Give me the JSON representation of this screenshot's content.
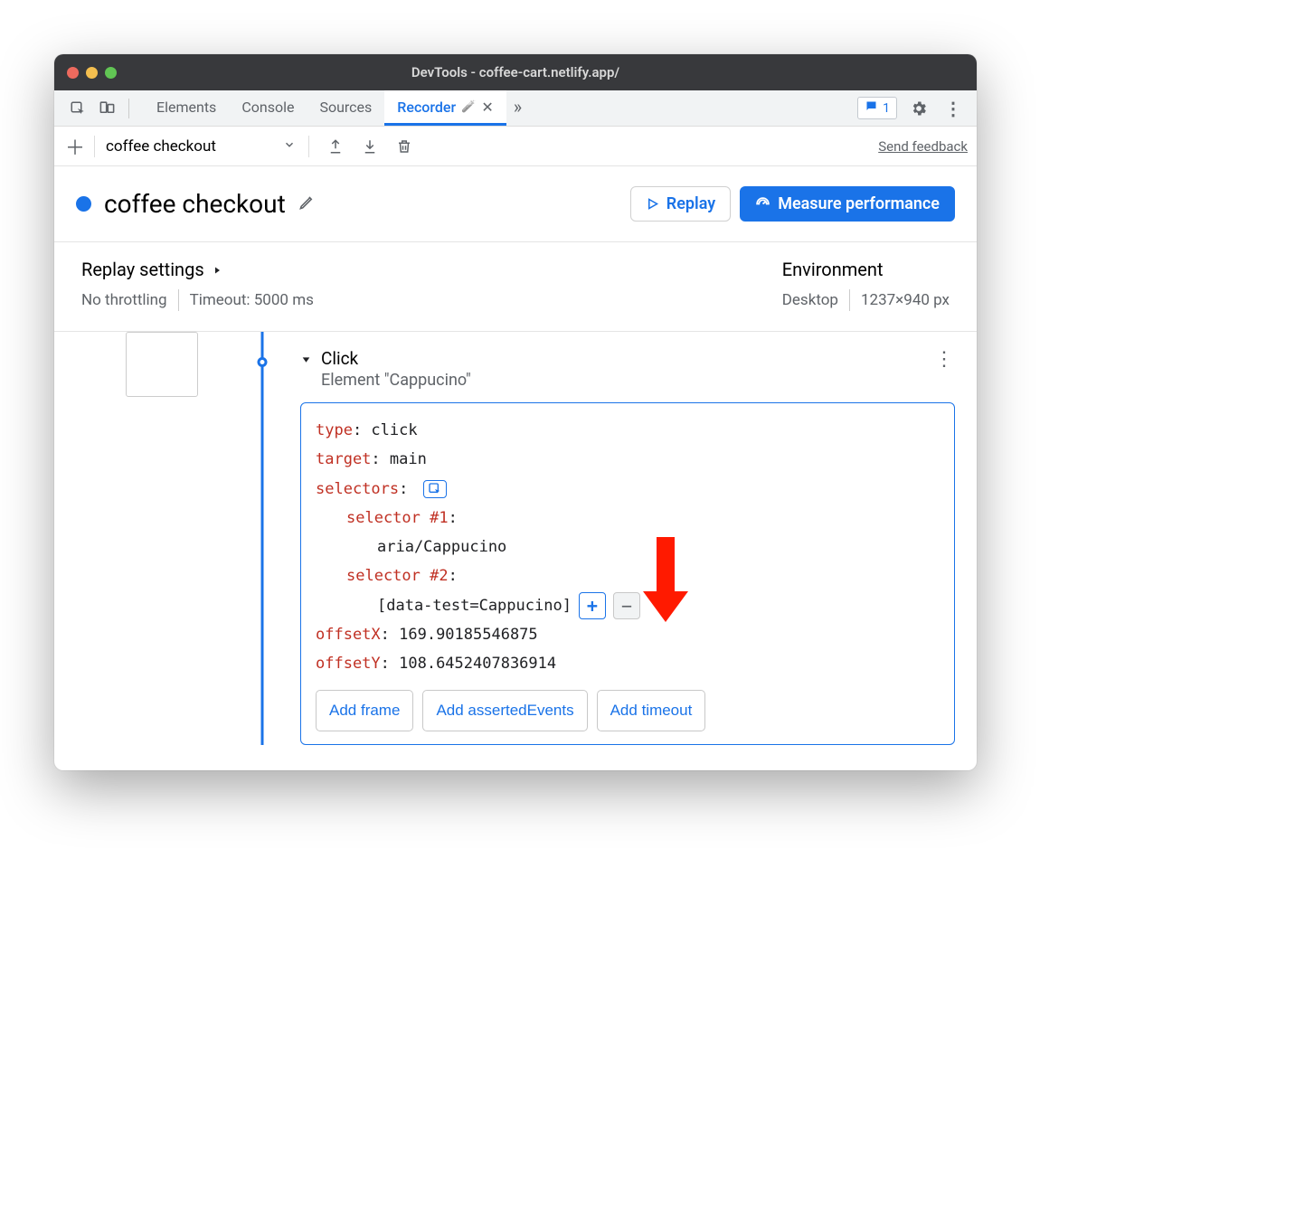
{
  "title": "DevTools - coffee-cart.netlify.app/",
  "tabs": {
    "elements": "Elements",
    "console": "Console",
    "sources": "Sources",
    "recorder": "Recorder"
  },
  "issues_count": "1",
  "rec": {
    "flow_name": "coffee checkout",
    "send_feedback": "Send feedback",
    "title": "coffee checkout",
    "replay": "Replay",
    "measure": "Measure performance"
  },
  "settings": {
    "replay_title": "Replay settings",
    "throttling": "No throttling",
    "timeout": "Timeout: 5000 ms",
    "env_title": "Environment",
    "device": "Desktop",
    "dimensions": "1237×940 px"
  },
  "step": {
    "name": "Click",
    "sub": "Element \"Cappucino\"",
    "l_type_k": "type",
    "l_type_v": ": click",
    "l_target_k": "target",
    "l_target_v": ": main",
    "l_selectors_k": "selectors",
    "l_selectors_v": ":",
    "l_sel1_k": "selector #1",
    "l_sel1_v": ":",
    "l_sel1_val": "aria/Cappucino",
    "l_sel2_k": "selector #2",
    "l_sel2_v": ":",
    "l_sel2_val": "[data-test=Cappucino]",
    "l_offx_k": "offsetX",
    "l_offx_v": ": 169.90185546875",
    "l_offy_k": "offsetY",
    "l_offy_v": ": 108.6452407836914",
    "add_frame": "Add frame",
    "add_asserted": "Add assertedEvents",
    "add_timeout": "Add timeout"
  }
}
